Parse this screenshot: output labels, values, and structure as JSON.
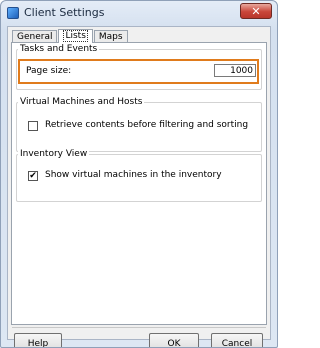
{
  "window": {
    "title": "Client Settings",
    "close_glyph": "✕",
    "icon": "app-icon"
  },
  "tabs": [
    {
      "label": "General",
      "active": false
    },
    {
      "label": "Lists",
      "active": true
    },
    {
      "label": "Maps",
      "active": false
    }
  ],
  "tasks_group": {
    "title": "Tasks and Events",
    "page_size_label": "Page size:",
    "page_size_value": "1000",
    "highlight_color": "#e07b1c"
  },
  "vm_group": {
    "title": "Virtual Machines and Hosts",
    "checkbox_label": "Retrieve contents before filtering and sorting",
    "checked": false
  },
  "inventory_group": {
    "title": "Inventory View",
    "checkbox_label": "Show virtual machines in the inventory",
    "checked": true,
    "check_glyph": "✔"
  },
  "buttons": {
    "help": "Help",
    "ok": "OK",
    "cancel": "Cancel"
  }
}
